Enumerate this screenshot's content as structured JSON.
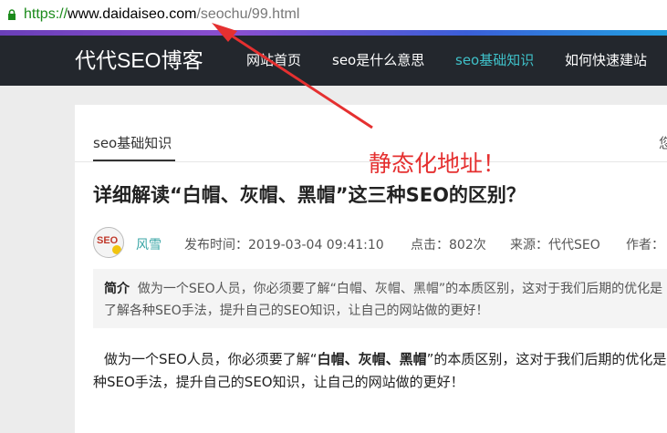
{
  "browser": {
    "url_scheme": "https://",
    "url_host": "www.daidaiseo.com",
    "url_path": "/seochu/99.html"
  },
  "navbar": {
    "brand": "代代SEO博客",
    "items": [
      {
        "label": "网站首页"
      },
      {
        "label": "seo是什么意思"
      },
      {
        "label": "seo基础知识"
      },
      {
        "label": "如何快速建站"
      }
    ],
    "active_color": "#3fc1c9"
  },
  "article": {
    "breadcrumb": "seo基础知识",
    "right_glyph": "您",
    "title": "详细解读“白帽、灰帽、黑帽”这三种SEO的区别？",
    "author": "风雪",
    "publish_time": "发布时间：2019-03-04 09:41:10",
    "views": "点击：802次",
    "source": "来源：代代SEO",
    "writer_label": "作者：",
    "summary_label": "简介",
    "summary_line1": "做为一个SEO人员，你必须要了解“白帽、灰帽、黑帽”的本质区别，这对于我们后期的优化是",
    "summary_line2": "了解各种SEO手法，提升自己的SEO知识，让自己的网站做的更好！",
    "body_line1_pre": "做为一个SEO人员，你必须要了解“",
    "body_line1_bold": "白帽、灰帽、黑帽",
    "body_line1_post": "”的本质区别，这对于我们后期的优化是",
    "body_line2": "种SEO手法，提升自己的SEO知识，让自己的网站做的更好！"
  },
  "annotation": {
    "text": "静态化地址！",
    "color": "#e53030"
  }
}
